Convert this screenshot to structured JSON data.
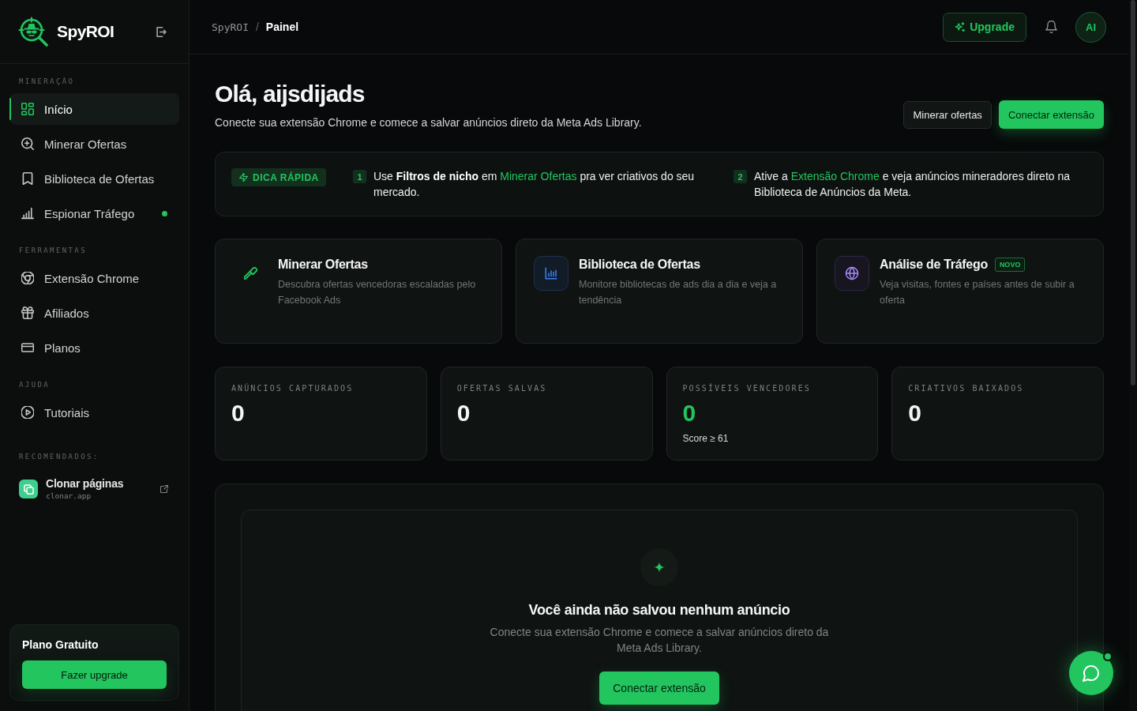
{
  "sidebar": {
    "brand": "SpyROI",
    "sections": [
      {
        "title": "MINERAÇÃO",
        "items": [
          {
            "label": "Início",
            "selected": true,
            "indicator": false
          },
          {
            "label": "Minerar Ofertas",
            "selected": false,
            "indicator": false
          },
          {
            "label": "Biblioteca de Ofertas",
            "selected": false,
            "indicator": false
          },
          {
            "label": "Espionar Tráfego",
            "selected": false,
            "indicator": true
          }
        ]
      },
      {
        "title": "FERRAMENTAS",
        "items": [
          {
            "label": "Extensão Chrome",
            "selected": false,
            "indicator": false
          },
          {
            "label": "Afiliados",
            "selected": false,
            "indicator": false
          },
          {
            "label": "Planos",
            "selected": false,
            "indicator": false
          }
        ]
      },
      {
        "title": "AJUDA",
        "items": [
          {
            "label": "Tutoriais",
            "selected": false,
            "indicator": false
          }
        ]
      }
    ],
    "recommended": {
      "title": "RECOMENDADOS:",
      "items": [
        {
          "name": "Clonar páginas",
          "url": "clonar.app"
        }
      ]
    },
    "plan": {
      "title": "Plano Gratuito",
      "button": "Fazer upgrade"
    }
  },
  "topbar": {
    "breadcrumb": [
      {
        "label": "SpyROI",
        "current": false
      },
      {
        "label": "Painel",
        "current": true
      }
    ],
    "separator": "/",
    "upgrade_button": "Upgrade",
    "avatar": "AI"
  },
  "header": {
    "title": "Olá, aijsdijads",
    "subtitle": "Conecte sua extensão Chrome e comece a salvar anúncios direto da Meta Ads Library.",
    "buttons": [
      {
        "label": "Minerar ofertas",
        "kind": "secondary"
      },
      {
        "label": "Conectar extensão",
        "kind": "primary"
      }
    ]
  },
  "tip": {
    "badge": "DICA RÁPIDA",
    "steps": [
      {
        "number": "1",
        "segments": [
          {
            "kind": "text",
            "text": "Use **Filtros de nicho** em "
          },
          {
            "kind": "link",
            "text": "Minerar Ofertas"
          },
          {
            "kind": "text",
            "text": " pra ver criativos do seu mercado."
          }
        ]
      },
      {
        "number": "2",
        "segments": [
          {
            "kind": "text",
            "text": "Ative a "
          },
          {
            "kind": "link",
            "text": "Extensão Chrome"
          },
          {
            "kind": "text",
            "text": " e veja anúncios mineradores direto na Biblioteca de Anúncios da Meta."
          }
        ]
      }
    ]
  },
  "features": [
    {
      "title": "Minerar Ofertas",
      "description": "Descubra ofertas vencedoras escaladas pelo Facebook Ads"
    },
    {
      "title": "Biblioteca de Ofertas",
      "description": "Monitore bibliotecas de ads dia a dia e veja a tendência"
    },
    {
      "title": "Análise de Tráfego",
      "badge": "NOVO",
      "description": "Veja visitas, fontes e países antes de subir a oferta"
    }
  ],
  "stats": [
    {
      "label": "ANÚNCIOS CAPTURADOS",
      "value": "0",
      "color": "#f5f5f5"
    },
    {
      "label": "OFERTAS SALVAS",
      "value": "0",
      "color": "#f5f5f5"
    },
    {
      "label": "POSSÍVEIS VENCEDORES",
      "value": "0",
      "color": "#22c55e",
      "note": "Score ≥ 61"
    },
    {
      "label": "CRIATIVOS BAIXADOS",
      "value": "0",
      "color": "#f5f5f5"
    }
  ],
  "empty_state": {
    "title": "Você ainda não salvou nenhum anúncio",
    "description": "Conecte sua extensão Chrome e comece a salvar anúncios direto da Meta Ads Library.",
    "button": "Conectar extensão"
  },
  "chat": {
    "unread": true
  }
}
